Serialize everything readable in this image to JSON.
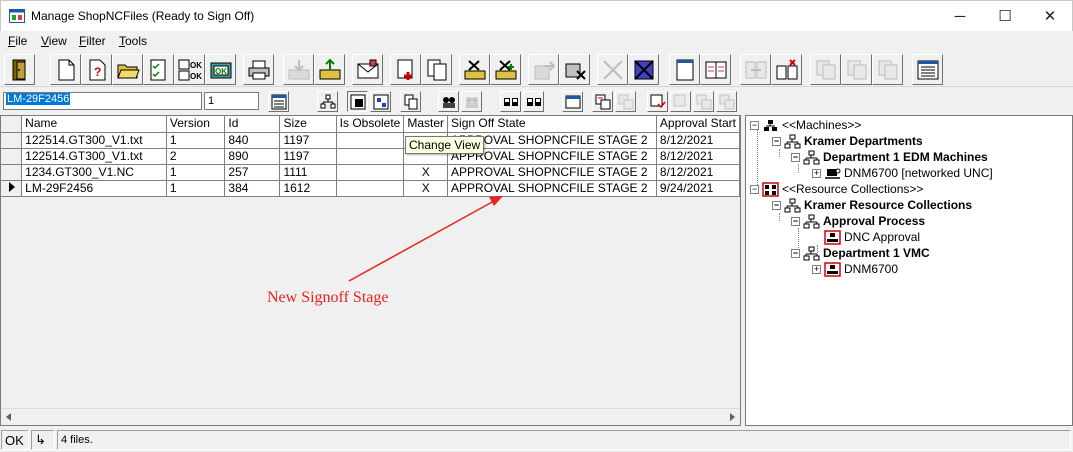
{
  "window": {
    "title": "Manage ShopNCFiles (Ready to Sign Off)",
    "minimize": "─",
    "maximize": "☐",
    "close": "✕"
  },
  "menu": [
    {
      "label": "File"
    },
    {
      "label": "View"
    },
    {
      "label": "Filter"
    },
    {
      "label": "Tools"
    }
  ],
  "search": {
    "filename": "LM-29F2456",
    "version": "1"
  },
  "tooltip": "Change View",
  "grid": {
    "columns": [
      "Name",
      "Version",
      "Id",
      "Size",
      "Is Obsolete",
      "Master",
      "Sign Off State",
      "Approval Start"
    ],
    "rows": [
      {
        "name": "122514.GT300_V1.txt",
        "version": "1",
        "id": "840",
        "size": "1197",
        "obsolete": "",
        "master": "",
        "state": "APPROVAL SHOPNCFILE STAGE 2",
        "start": "8/12/2021",
        "current": false
      },
      {
        "name": "122514.GT300_V1.txt",
        "version": "2",
        "id": "890",
        "size": "1197",
        "obsolete": "",
        "master": "",
        "state": "APPROVAL SHOPNCFILE STAGE 2",
        "start": "8/12/2021",
        "current": false
      },
      {
        "name": "1234.GT300_V1.NC",
        "version": "1",
        "id": "257",
        "size": "1111",
        "obsolete": "",
        "master": "X",
        "state": "APPROVAL SHOPNCFILE STAGE 2",
        "start": "8/12/2021",
        "current": false
      },
      {
        "name": "LM-29F2456",
        "version": "1",
        "id": "384",
        "size": "1612",
        "obsolete": "",
        "master": "X",
        "state": "APPROVAL SHOPNCFILE STAGE 2",
        "start": "9/24/2021",
        "current": true
      }
    ]
  },
  "annotation": {
    "text": "New Signoff Stage",
    "color": "#e8221c"
  },
  "tree": {
    "machines_root": "<<Machines>>",
    "kramer_departments": "Kramer Departments",
    "dept1_edm": "Department 1 EDM Machines",
    "dnm6700_unc": "DNM6700 [networked UNC]",
    "resource_root": "<<Resource Collections>>",
    "kramer_resources": "Kramer Resource Collections",
    "approval_process": "Approval Process",
    "dnc_approval": "DNC Approval",
    "dept1_vmc": "Department 1 VMC",
    "dnm6700": "DNM6700"
  },
  "status": {
    "ok": "OK",
    "arrow": "↳",
    "files": "4 files."
  },
  "colors": {
    "accent": "#0078d7",
    "annotation": "#e8221c"
  }
}
